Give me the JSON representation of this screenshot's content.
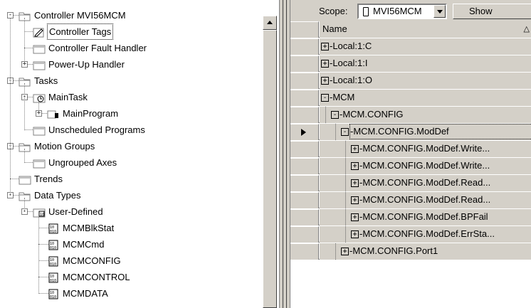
{
  "tree": {
    "items": [
      {
        "label": "Controller MVI56MCM",
        "depth": 0,
        "expander": "−",
        "icon": "folder-open-icon"
      },
      {
        "label": "Controller Tags",
        "depth": 1,
        "expander": "",
        "icon": "tags-icon",
        "selected": true
      },
      {
        "label": "Controller Fault Handler",
        "depth": 1,
        "expander": "",
        "icon": "folder-icon"
      },
      {
        "label": "Power-Up Handler",
        "depth": 1,
        "expander": "+",
        "icon": "folder-icon"
      },
      {
        "label": "Tasks",
        "depth": 0,
        "expander": "−",
        "icon": "folder-open-icon"
      },
      {
        "label": "MainTask",
        "depth": 1,
        "expander": "−",
        "icon": "task-icon"
      },
      {
        "label": "MainProgram",
        "depth": 2,
        "expander": "+",
        "icon": "program-icon"
      },
      {
        "label": "Unscheduled Programs",
        "depth": 1,
        "expander": "",
        "icon": "folder-icon"
      },
      {
        "label": "Motion Groups",
        "depth": 0,
        "expander": "−",
        "icon": "folder-open-icon"
      },
      {
        "label": "Ungrouped Axes",
        "depth": 1,
        "expander": "",
        "icon": "folder-icon"
      },
      {
        "label": "Trends",
        "depth": 0,
        "expander": "",
        "icon": "folder-icon"
      },
      {
        "label": "Data Types",
        "depth": 0,
        "expander": "−",
        "icon": "folder-open-icon"
      },
      {
        "label": "User-Defined",
        "depth": 1,
        "expander": "−",
        "icon": "datatype-folder-icon"
      },
      {
        "label": "MCMBlkStat",
        "depth": 2,
        "expander": "",
        "icon": "datatype-icon"
      },
      {
        "label": "MCMCmd",
        "depth": 2,
        "expander": "",
        "icon": "datatype-icon"
      },
      {
        "label": "MCMCONFIG",
        "depth": 2,
        "expander": "",
        "icon": "datatype-icon"
      },
      {
        "label": "MCMCONTROL",
        "depth": 2,
        "expander": "",
        "icon": "datatype-icon"
      },
      {
        "label": "MCMDATA",
        "depth": 2,
        "expander": "",
        "icon": "datatype-icon"
      }
    ]
  },
  "toolbar": {
    "scope_label": "Scope:",
    "scope_value": "MVI56MCM",
    "show_label": "Show"
  },
  "grid": {
    "header": "Name",
    "sort_glyph": "△",
    "rows": [
      {
        "name": "Local:1:C",
        "depth": 0,
        "expander": "+"
      },
      {
        "name": "Local:1:I",
        "depth": 0,
        "expander": "+"
      },
      {
        "name": "Local:1:O",
        "depth": 0,
        "expander": "+"
      },
      {
        "name": "MCM",
        "depth": 0,
        "expander": "−"
      },
      {
        "name": "MCM.CONFIG",
        "depth": 1,
        "expander": "−"
      },
      {
        "name": "MCM.CONFIG.ModDef",
        "depth": 2,
        "expander": "−",
        "current": true
      },
      {
        "name": "MCM.CONFIG.ModDef.Write...",
        "depth": 3,
        "expander": "+"
      },
      {
        "name": "MCM.CONFIG.ModDef.Write...",
        "depth": 3,
        "expander": "+"
      },
      {
        "name": "MCM.CONFIG.ModDef.Read...",
        "depth": 3,
        "expander": "+"
      },
      {
        "name": "MCM.CONFIG.ModDef.Read...",
        "depth": 3,
        "expander": "+"
      },
      {
        "name": "MCM.CONFIG.ModDef.BPFail",
        "depth": 3,
        "expander": "+"
      },
      {
        "name": "MCM.CONFIG.ModDef.ErrSta...",
        "depth": 3,
        "expander": "+"
      },
      {
        "name": "MCM.CONFIG.Port1",
        "depth": 2,
        "expander": "+"
      }
    ]
  }
}
